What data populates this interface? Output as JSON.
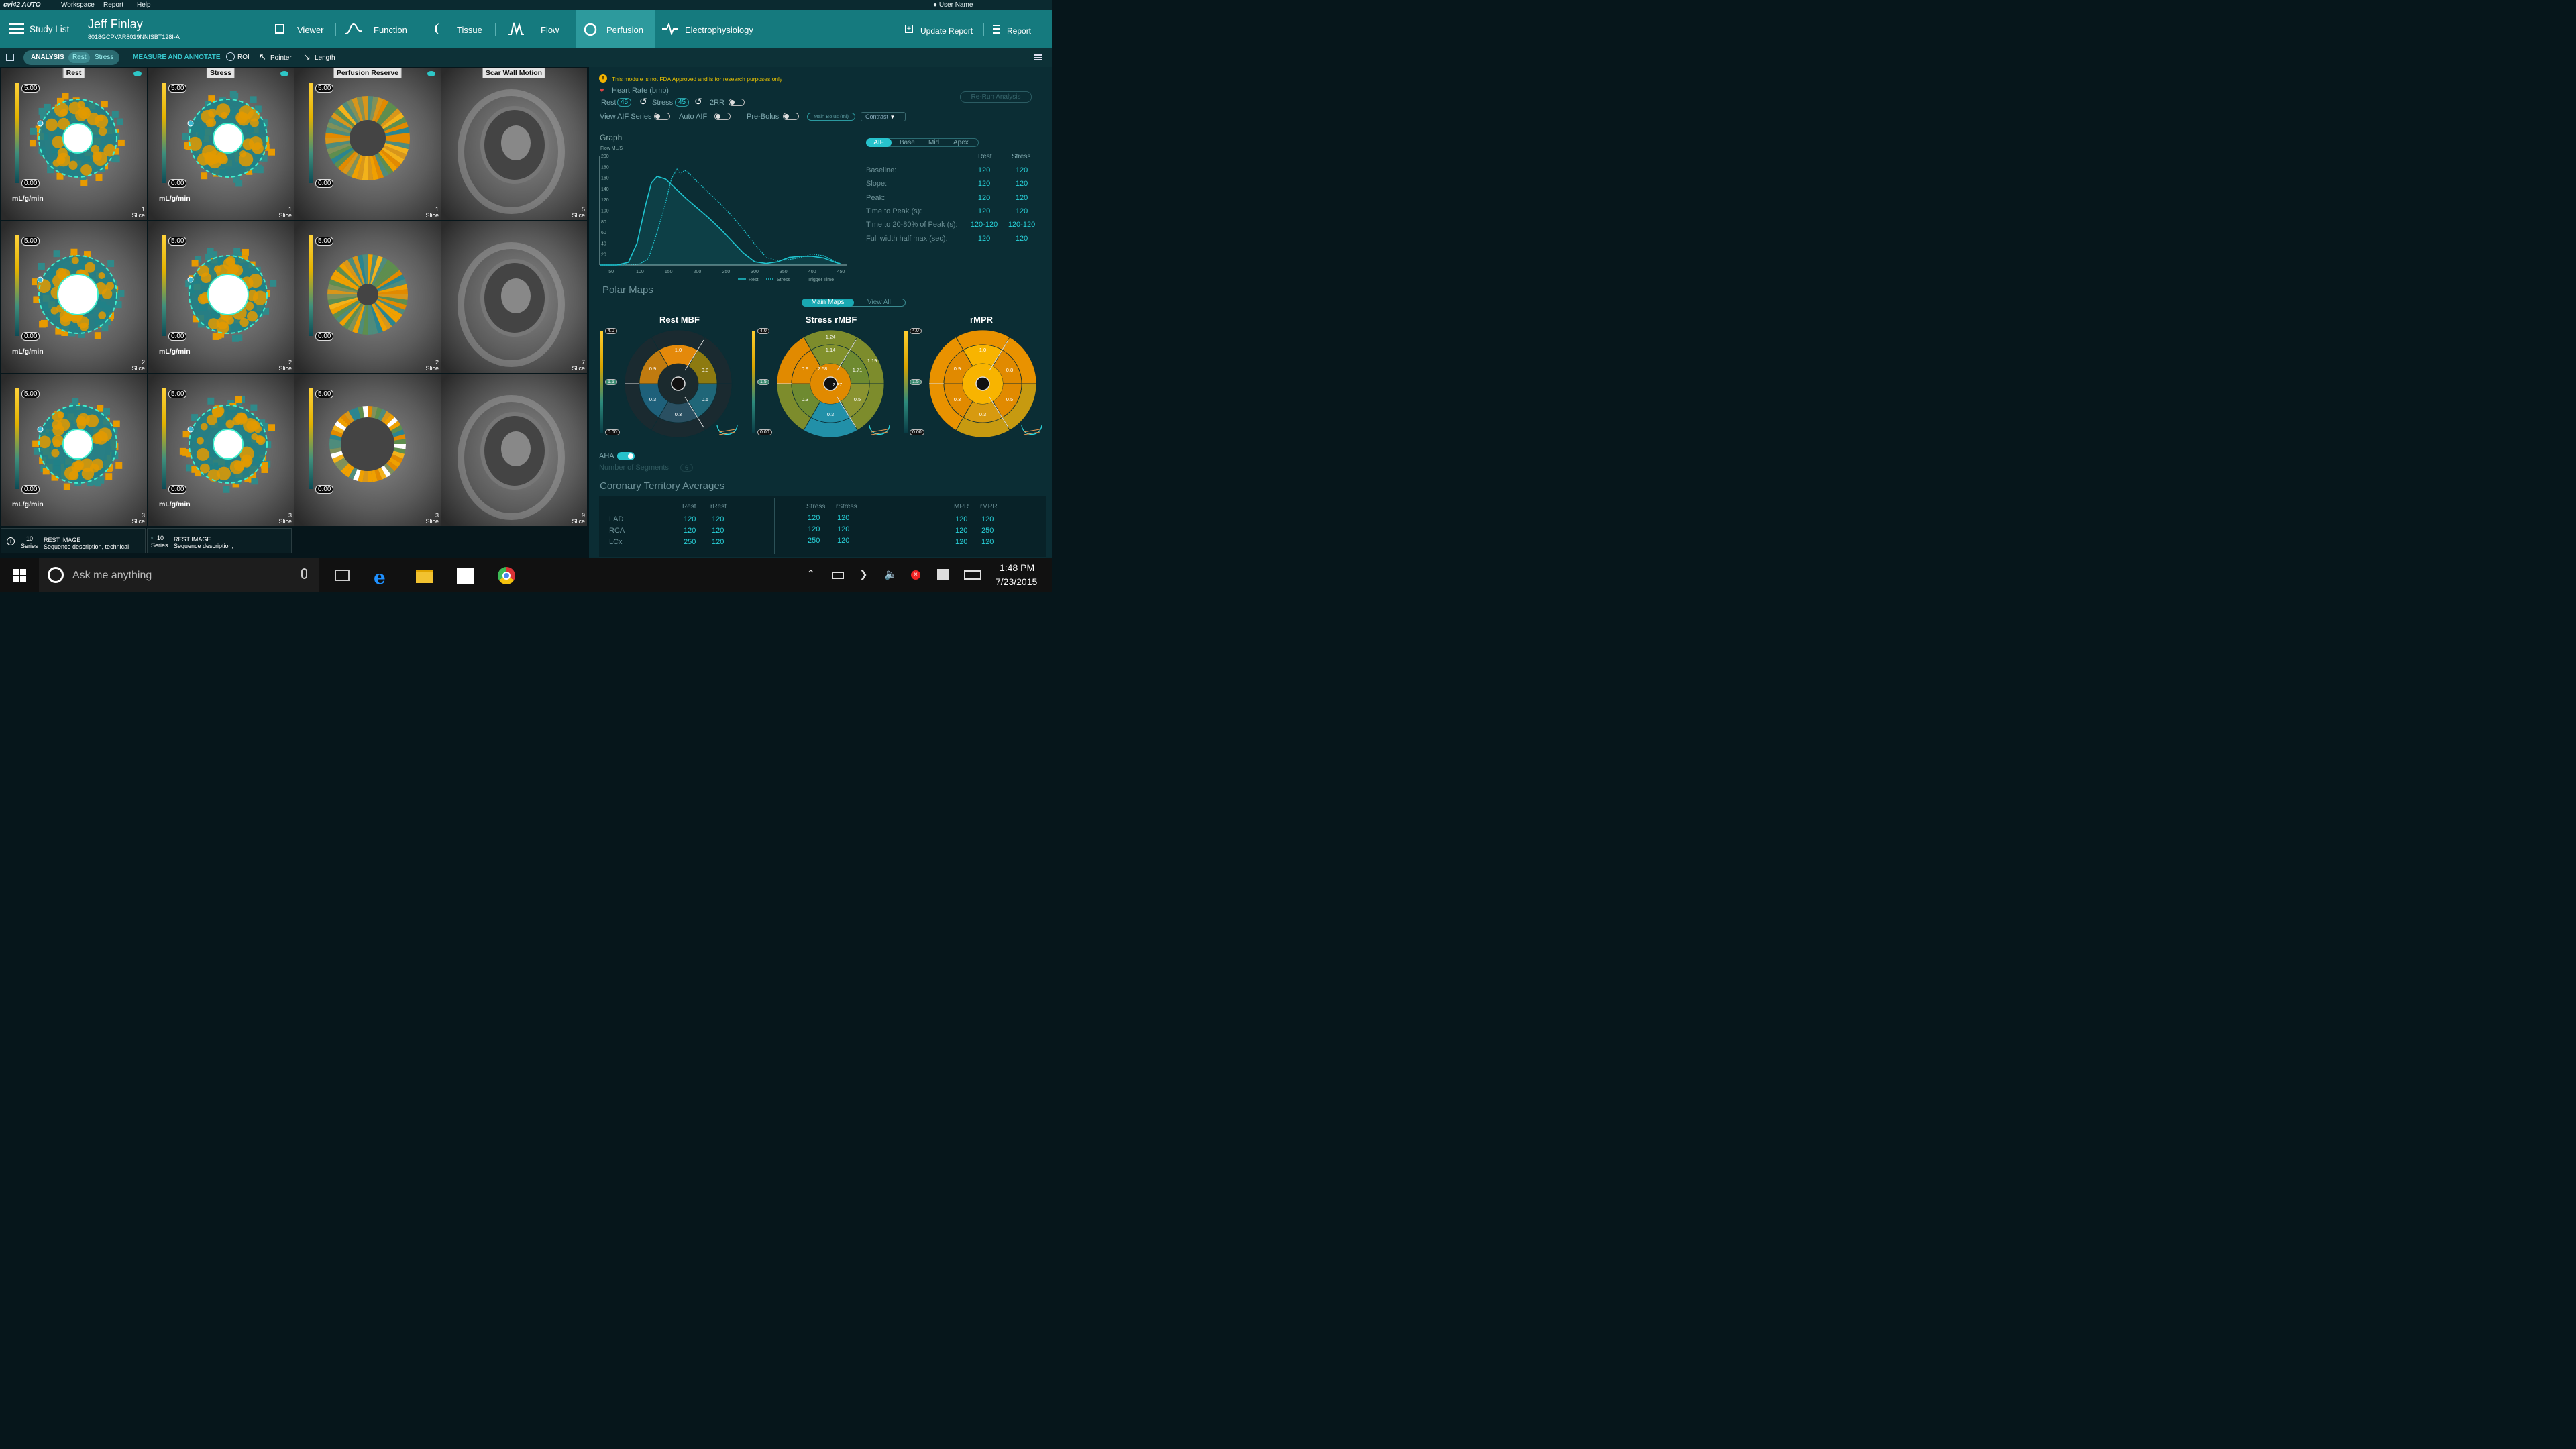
{
  "menubar": {
    "app": "cvi42 AUTO",
    "items": [
      "Workspace",
      "Report",
      "Help"
    ],
    "user": "User Name"
  },
  "header": {
    "study_list": "Study List",
    "patient_name": "Jeff Finlay",
    "patient_id": "8018GCPVAR8019NNISBT128I-A",
    "nav": [
      "Viewer",
      "Function",
      "Tissue",
      "Flow",
      "Perfusion",
      "Electrophysiology"
    ],
    "update_report": "Update Report",
    "report": "Report"
  },
  "toolbar": {
    "analysis": "ANALYSIS",
    "rest": "Rest",
    "stress": "Stress",
    "measure": "MEASURE AND ANNOTATE",
    "roi": "ROI",
    "pointer": "Pointer",
    "length": "Length"
  },
  "viewports": {
    "columns": [
      "Rest",
      "Stress",
      "Perfusion Reserve",
      "Scar Wall Motion"
    ],
    "colorbar_max": "5.00",
    "colorbar_min": "0.00",
    "unit": "mL/g/min",
    "slice_word": "Slice",
    "slices": [
      [
        "1",
        "1",
        "1",
        "5"
      ],
      [
        "2",
        "2",
        "2",
        "7"
      ],
      [
        "3",
        "3",
        "3",
        "9"
      ]
    ]
  },
  "series": [
    {
      "num": "10",
      "word": "Series",
      "title": "REST IMAGE",
      "desc": "Sequence description, technical"
    },
    {
      "num": "10",
      "word": "Series",
      "title": "REST IMAGE",
      "desc": "Sequence description,"
    }
  ],
  "panel": {
    "warning": "This module is not FDA Approved and is for research purposes only",
    "heart_rate": "Heart Rate (bmp)",
    "rest": "Rest",
    "rest_val": "45",
    "stress": "Stress",
    "stress_val": "45",
    "rr": "2RR",
    "view_aif": "View AIF Series",
    "auto_aif": "Auto AIF",
    "pre_bolus": "Pre-Bolus",
    "main_bolus": "Main Bolus (ml)",
    "contrast": "Contrast",
    "rerun": "Re-Run Analysis",
    "graph_title": "Graph",
    "segments": [
      "AIF",
      "Base",
      "Mid",
      "Apex"
    ],
    "table": {
      "headers": [
        "Rest",
        "Stress"
      ],
      "rows": [
        [
          "Baseline:",
          "120",
          "120"
        ],
        [
          "Slope:",
          "120",
          "120"
        ],
        [
          "Peak:",
          "120",
          "120"
        ],
        [
          "Time to Peak (s):",
          "120",
          "120"
        ],
        [
          "Time to 20-80%  of Peak (s):",
          "120-120",
          "120-120"
        ],
        [
          "Full width half max (sec):",
          "120",
          "120"
        ]
      ]
    },
    "polar_title": "Polar Maps",
    "main_maps": "Main Maps",
    "view_all": "View All",
    "polar": [
      {
        "title": "Rest MBF",
        "outer": [],
        "mid": [
          "1.0",
          "0.8",
          "0.5",
          "0.3",
          "0.3",
          "0.9"
        ],
        "inner": []
      },
      {
        "title": "Stress rMBF",
        "outer": [
          "1.24",
          "1.19"
        ],
        "mid": [
          "1.14",
          "1.71",
          "0.5",
          "0.3",
          "0.3",
          "0.9"
        ],
        "inner": [
          "2.58",
          "2.37"
        ]
      },
      {
        "title": "rMPR",
        "outer": [],
        "mid": [
          "1.0",
          "0.8",
          "0.5",
          "0.3",
          "0.3",
          "0.9"
        ],
        "inner": []
      }
    ],
    "polar_scale": [
      "4.0",
      "1.5",
      "0.00"
    ],
    "aha": "AHA",
    "num_segments": "Number of Segments",
    "num_segments_val": "6",
    "territory_title": "Coronary Territory Averages",
    "territory": {
      "groups": [
        [
          "Rest",
          "rRest"
        ],
        [
          "Stress",
          "rStress"
        ],
        [
          "MPR",
          "rMPR"
        ]
      ],
      "rows": [
        {
          "name": "LAD",
          "vals": [
            "120",
            "120",
            "120",
            "120",
            "120",
            "120"
          ]
        },
        {
          "name": "RCA",
          "vals": [
            "120",
            "120",
            "120",
            "120",
            "120",
            "250"
          ]
        },
        {
          "name": "LCx",
          "vals": [
            "250",
            "120",
            "250",
            "120",
            "120",
            "120"
          ]
        }
      ]
    }
  },
  "chart_data": {
    "type": "line",
    "title": "Graph",
    "ylabel": "Flow ML/S",
    "xlabel": "Trigger Time",
    "xlim": [
      30,
      460
    ],
    "ylim": [
      0,
      200
    ],
    "x_ticks": [
      50,
      100,
      150,
      200,
      250,
      300,
      350,
      400,
      450
    ],
    "y_ticks": [
      20,
      40,
      60,
      80,
      100,
      120,
      140,
      160,
      180,
      200
    ],
    "series": [
      {
        "name": "Rest",
        "style": "solid",
        "x": [
          30,
          60,
          80,
          95,
          110,
          120,
          130,
          145,
          160,
          180,
          200,
          220,
          240,
          260,
          280,
          300,
          320,
          340,
          360,
          380,
          400,
          420,
          440,
          450
        ],
        "y": [
          0,
          0,
          5,
          40,
          110,
          150,
          162,
          157,
          142,
          122,
          104,
          86,
          66,
          44,
          22,
          6,
          3,
          6,
          14,
          16,
          16,
          13,
          5,
          2
        ]
      },
      {
        "name": "Stress",
        "style": "dotted",
        "x": [
          30,
          70,
          100,
          115,
          130,
          145,
          155,
          165,
          170,
          178,
          185,
          200,
          220,
          240,
          260,
          280,
          300,
          320,
          340,
          360,
          380,
          400,
          420,
          440,
          450
        ],
        "y": [
          0,
          0,
          2,
          12,
          60,
          115,
          158,
          176,
          166,
          173,
          168,
          152,
          132,
          112,
          90,
          65,
          38,
          14,
          8,
          10,
          14,
          20,
          17,
          7,
          2
        ]
      }
    ],
    "colors": {
      "rest": "#1fc4cf",
      "stress": "#1fc4cf",
      "axis": "#9bb",
      "grid": "#2a4a50"
    }
  },
  "taskbar": {
    "search": "Ask me anything",
    "time": "1:48 PM",
    "date": "7/23/2015"
  }
}
